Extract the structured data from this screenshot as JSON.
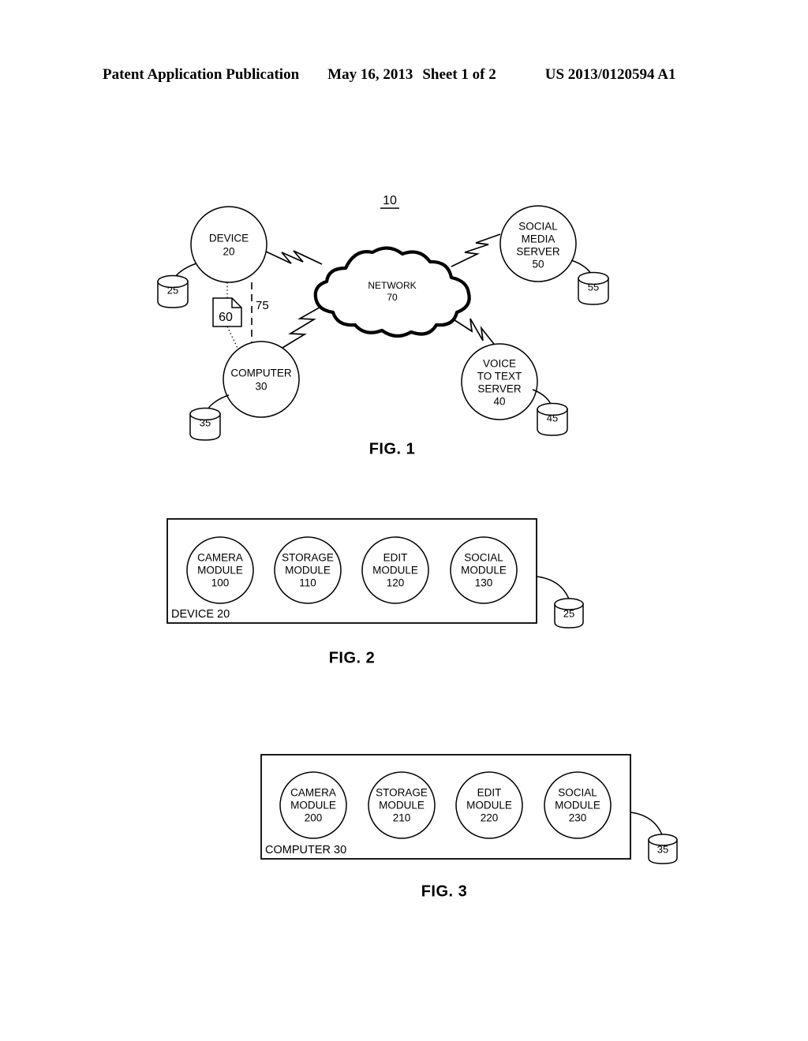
{
  "header": {
    "publication": "Patent Application Publication",
    "date": "May 16, 2013",
    "sheet": "Sheet 1 of 2",
    "patent_number": "US 2013/0120594 A1"
  },
  "figures": [
    {
      "id": "fig1",
      "caption": "FIG. 1",
      "system_ref": "10",
      "nodes": [
        {
          "name": "device",
          "label_lines": [
            "DEVICE"
          ],
          "ref": "20"
        },
        {
          "name": "computer",
          "label_lines": [
            "COMPUTER"
          ],
          "ref": "30"
        },
        {
          "name": "network",
          "label_lines": [
            "NETWORK"
          ],
          "ref": "70"
        },
        {
          "name": "voice-to-text-server",
          "label_lines": [
            "VOICE",
            "TO TEXT",
            "SERVER"
          ],
          "ref": "40"
        },
        {
          "name": "social-media-server",
          "label_lines": [
            "SOCIAL",
            "MEDIA",
            "SERVER"
          ],
          "ref": "50"
        }
      ],
      "databases": [
        {
          "name": "device-database",
          "ref": "25"
        },
        {
          "name": "computer-database",
          "ref": "35"
        },
        {
          "name": "voice-to-text-server-database",
          "ref": "45"
        },
        {
          "name": "social-media-server-database",
          "ref": "55"
        }
      ],
      "document": {
        "name": "media-file-document",
        "ref": "60"
      },
      "direct_link": {
        "name": "direct-connection",
        "ref": "75"
      }
    },
    {
      "id": "fig2",
      "caption": "FIG. 2",
      "container_label": "DEVICE 20",
      "modules": [
        {
          "label_lines": [
            "CAMERA",
            "MODULE"
          ],
          "ref": "100"
        },
        {
          "label_lines": [
            "STORAGE",
            "MODULE"
          ],
          "ref": "110"
        },
        {
          "label_lines": [
            "EDIT",
            "MODULE"
          ],
          "ref": "120"
        },
        {
          "label_lines": [
            "SOCIAL",
            "MODULE"
          ],
          "ref": "130"
        }
      ],
      "database": {
        "name": "device-database",
        "ref": "25"
      }
    },
    {
      "id": "fig3",
      "caption": "FIG. 3",
      "container_label": "COMPUTER 30",
      "modules": [
        {
          "label_lines": [
            "CAMERA",
            "MODULE"
          ],
          "ref": "200"
        },
        {
          "label_lines": [
            "STORAGE",
            "MODULE"
          ],
          "ref": "210"
        },
        {
          "label_lines": [
            "EDIT",
            "MODULE"
          ],
          "ref": "220"
        },
        {
          "label_lines": [
            "SOCIAL",
            "MODULE"
          ],
          "ref": "230"
        }
      ],
      "database": {
        "name": "computer-database",
        "ref": "35"
      }
    }
  ],
  "colors": {
    "ink": "#000000",
    "paper": "#ffffff"
  }
}
